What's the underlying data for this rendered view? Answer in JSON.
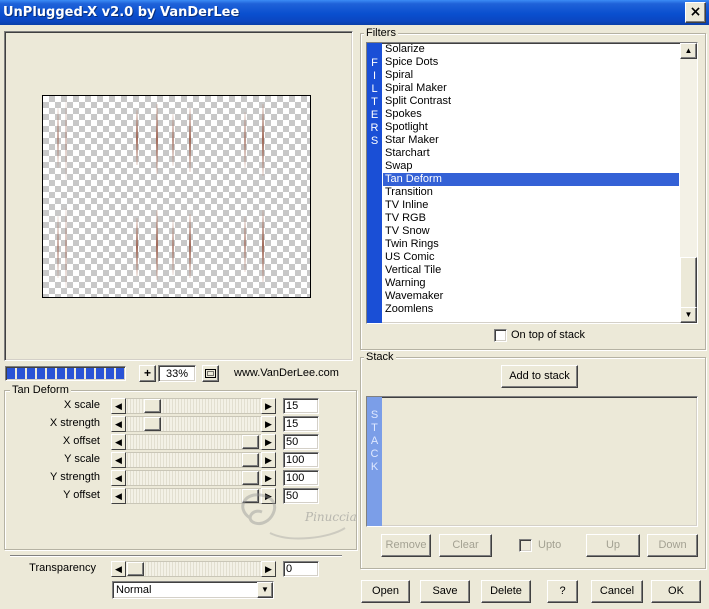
{
  "window": {
    "title": "UnPlugged-X v2.0 by VanDerLee",
    "close_label": "×"
  },
  "preview": {
    "progress_blocks": 12,
    "zoom_plus": "+",
    "zoom_value": "33%",
    "url": "www.VanDerLee.com"
  },
  "params": {
    "group_title": "Tan Deform",
    "items": [
      {
        "label": "X scale",
        "value": "15"
      },
      {
        "label": "X strength",
        "value": "15"
      },
      {
        "label": "X offset",
        "value": "50"
      },
      {
        "label": "Y scale",
        "value": "100"
      },
      {
        "label": "Y strength",
        "value": "100"
      },
      {
        "label": "Y offset",
        "value": "50"
      }
    ]
  },
  "transparency": {
    "label": "Transparency",
    "value": "0"
  },
  "blend": {
    "selected": "Normal"
  },
  "filters": {
    "group_title": "Filters",
    "tab_letters": [
      "F",
      "I",
      "L",
      "T",
      "E",
      "R",
      "S"
    ],
    "items": [
      "Solarize",
      "Spice Dots",
      "Spiral",
      "Spiral Maker",
      "Split Contrast",
      "Spokes",
      "Spotlight",
      "Star Maker",
      "Starchart",
      "Swap",
      "Tan Deform",
      "Transition",
      "TV Inline",
      "TV RGB",
      "TV Snow",
      "Twin Rings",
      "US Comic",
      "Vertical Tile",
      "Warning",
      "Wavemaker",
      "Zoomlens"
    ],
    "selected": "Tan Deform",
    "on_top_label": "On top of stack"
  },
  "stack": {
    "group_title": "Stack",
    "add_label": "Add to stack",
    "tab_letters": [
      "S",
      "T",
      "A",
      "C",
      "K"
    ],
    "remove_label": "Remove",
    "clear_label": "Clear",
    "upto_label": "Upto",
    "up_label": "Up",
    "down_label": "Down"
  },
  "footer": {
    "open_label": "Open",
    "save_label": "Save",
    "delete_label": "Delete",
    "help_label": "?",
    "cancel_label": "Cancel",
    "ok_label": "OK"
  },
  "watermark": {
    "text": "Pinuccia"
  }
}
